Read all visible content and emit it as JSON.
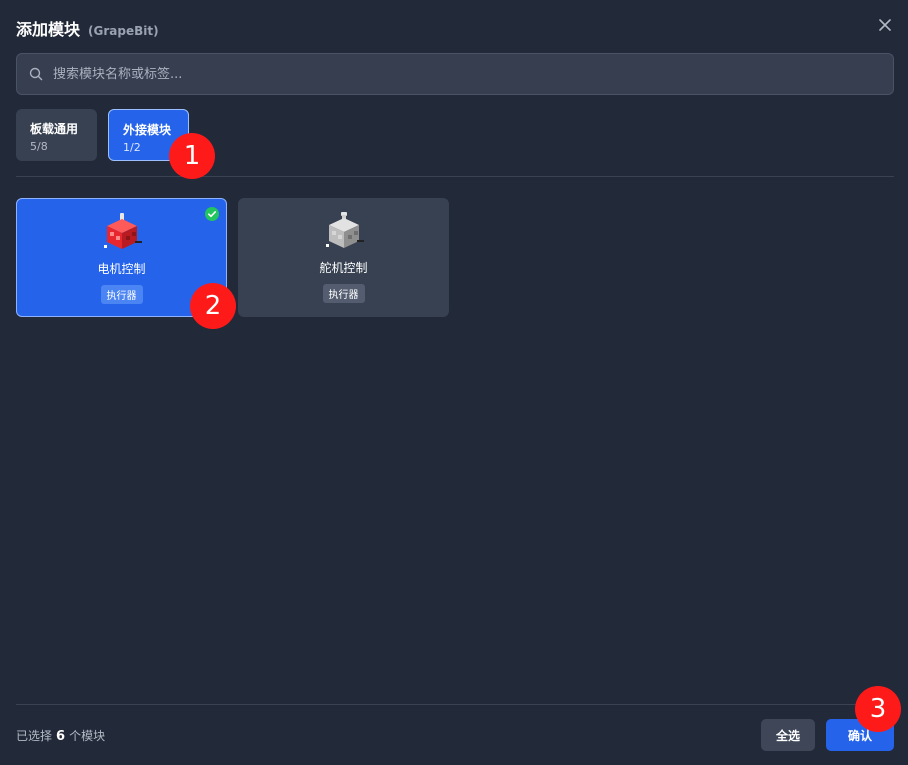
{
  "dialog": {
    "title": "添加模块",
    "subtitle": "(GrapeBit)"
  },
  "search": {
    "placeholder": "搜索模块名称或标签..."
  },
  "categories": [
    {
      "label": "板载通用",
      "count": "5/8",
      "active": false
    },
    {
      "label": "外接模块",
      "count": "1/2",
      "active": true
    }
  ],
  "modules": [
    {
      "name": "电机控制",
      "tag": "执行器",
      "selected": true,
      "color": "#e8262e"
    },
    {
      "name": "舵机控制",
      "tag": "执行器",
      "selected": false,
      "color": "#bdbdbd"
    }
  ],
  "annotations": [
    "1",
    "2",
    "3"
  ],
  "footer": {
    "prefix": "已选择",
    "count": "6",
    "suffix": "个模块",
    "select_all_label": "全选",
    "confirm_label": "确认"
  },
  "colors": {
    "accent": "#2563eb",
    "success": "#22c55e",
    "annotation": "#ff1a1a"
  }
}
